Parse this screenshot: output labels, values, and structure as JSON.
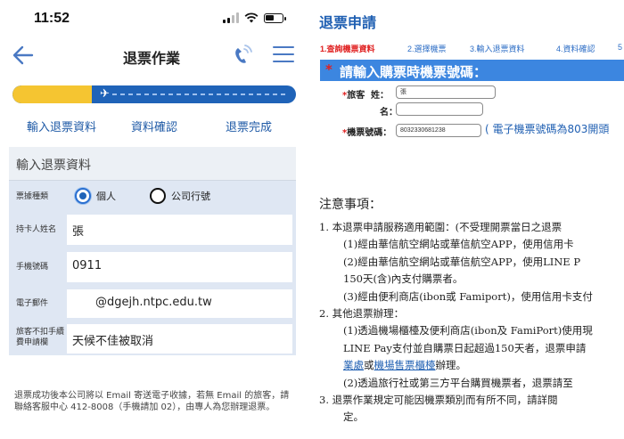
{
  "status_bar": {
    "time": "11:52"
  },
  "mobile": {
    "nav": {
      "title": "退票作業"
    },
    "progress": {
      "value": 0.28
    },
    "steps": [
      "輸入退票資料",
      "資料確認",
      "退票完成"
    ],
    "form": {
      "title": "輸入退票資料",
      "ticket_type": {
        "label": "票據種類",
        "options": [
          "個人",
          "公司行號"
        ],
        "selected": "個人"
      },
      "name": {
        "label": "持卡人姓名",
        "value": "張"
      },
      "phone": {
        "label": "手機號碼",
        "value": "0911"
      },
      "email": {
        "label": "電子郵件",
        "value": "@dgejh.ntpc.edu.tw"
      },
      "reason": {
        "label": "旅客不扣手續費申請欄",
        "value": "天候不佳被取消"
      }
    },
    "footer_note": "退票成功後本公司將以 Email 寄送電子收據，若無 Email 的旅客，請聯絡客服中心 412-8008（手機請加 02），由專人為您辦理退票。"
  },
  "web": {
    "title": "退票申請",
    "steps": [
      "1.查詢機票資料",
      "2.選擇機票",
      "3.輸入退票資料",
      "4.資料確認",
      "5"
    ],
    "banner": {
      "star": "*",
      "text": "請輸入購票時機票號碼："
    },
    "traveler": {
      "label": "旅客",
      "surname_label": "姓：",
      "surname_value": "張",
      "given_label": "名：",
      "given_value": ""
    },
    "ticket": {
      "label": "機票號碼：",
      "value": "8032330681238",
      "hint": "( 電子機票號碼為803開頭"
    },
    "notes_title": "注意事項：",
    "notes": [
      "1.  本退票申請服務適用範圍：(不受理開票當日之退票",
      "(1)經由華信航空網站或華信航空APP，使用信用卡",
      "(2)經由華信航空網站或華信航空APP，使用LINE P",
      "150天(含)內支付購票者。",
      "(3)經由便利商店(ibon或 Famiport)，使用信用卡支付",
      "2.  其他退票辦理：",
      "(1)透過機場櫃檯及便利商店(ibon及 FamiPort)使用現",
      "LINE Pay支付並自購票日起超過150天者，退票申請",
      "(2)透過旅行社或第三方平台購買機票者，退票請至",
      "3.  退票作業規定可能因機票類別而有所不同，請詳閱",
      "定。"
    ],
    "notes_link_line": {
      "link1": "業處",
      "mid": "或",
      "link2": "機場售票櫃檯",
      "end": "辦理。"
    },
    "colors": {
      "primary": "#1f5fb2",
      "banner": "#3c86e0",
      "required": "#e02020",
      "progress_fill": "#f5c531"
    }
  }
}
